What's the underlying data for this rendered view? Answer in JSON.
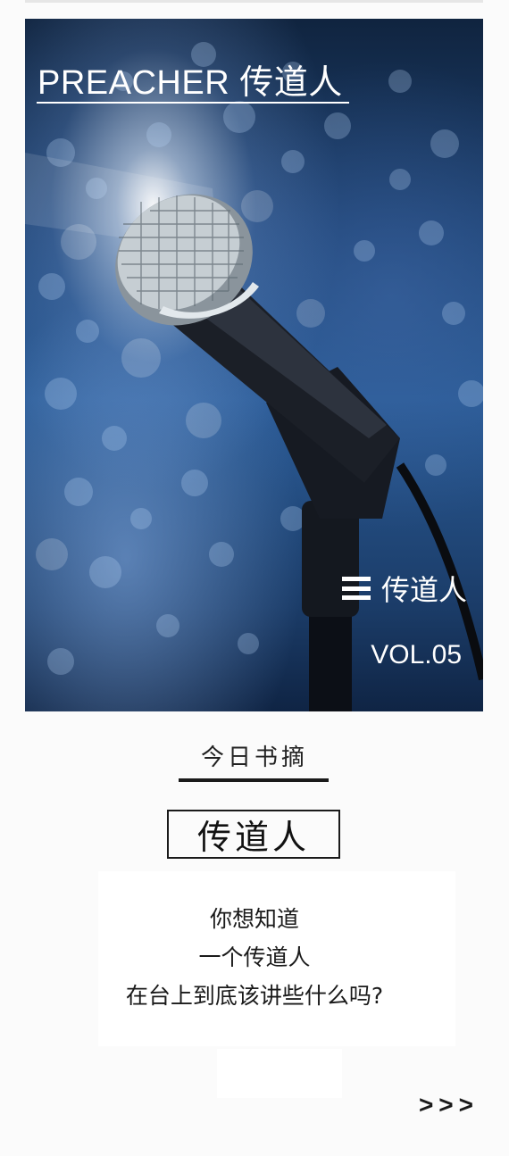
{
  "cover": {
    "title": "PREACHER 传道人",
    "menu_label": "传道人",
    "volume": "VOL.05",
    "icon": "menu-icon",
    "image": "microphone-photo"
  },
  "digest": {
    "section_title": "今日书摘",
    "book_title": "传道人",
    "lines": [
      "你想知道",
      "一个传道人",
      "在台上到底该讲些什么吗?"
    ],
    "more": ">>>"
  }
}
